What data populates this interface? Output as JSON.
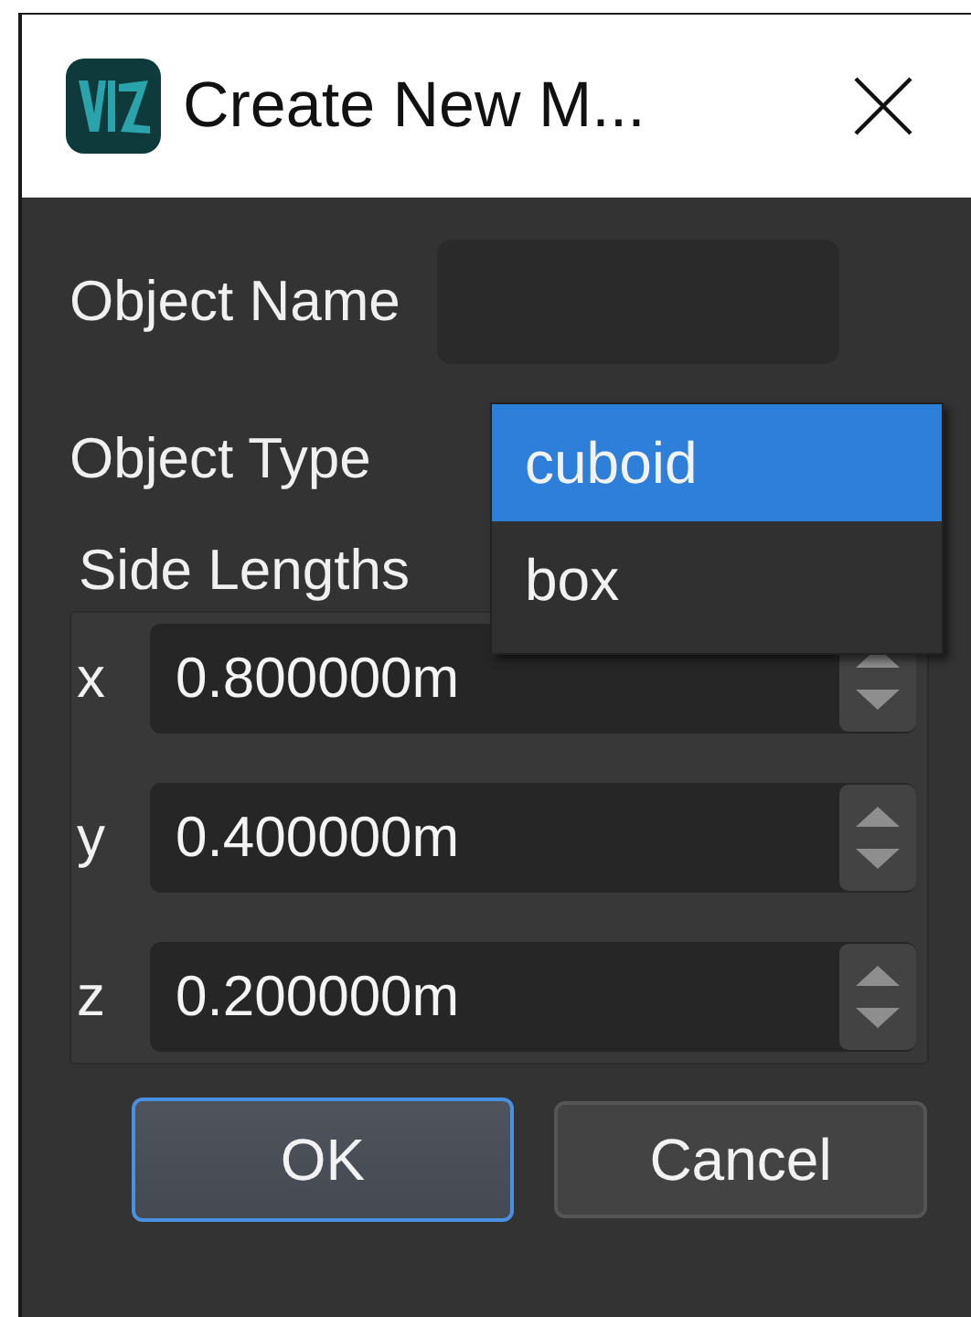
{
  "window": {
    "title": "Create New M..."
  },
  "object_name": {
    "label": "Object Name"
  },
  "object_type": {
    "label": "Object Type",
    "options": [
      {
        "label": "cuboid",
        "selected": true
      },
      {
        "label": "box",
        "selected": false
      }
    ]
  },
  "side_lengths": {
    "label": "Side Lengths",
    "axes": [
      {
        "label": "x",
        "value": "0.800000m"
      },
      {
        "label": "y",
        "value": "0.400000m"
      },
      {
        "label": "z",
        "value": "0.200000m"
      }
    ]
  },
  "buttons": [
    {
      "label": "OK",
      "default": true
    },
    {
      "label": "Cancel",
      "default": false
    }
  ]
}
